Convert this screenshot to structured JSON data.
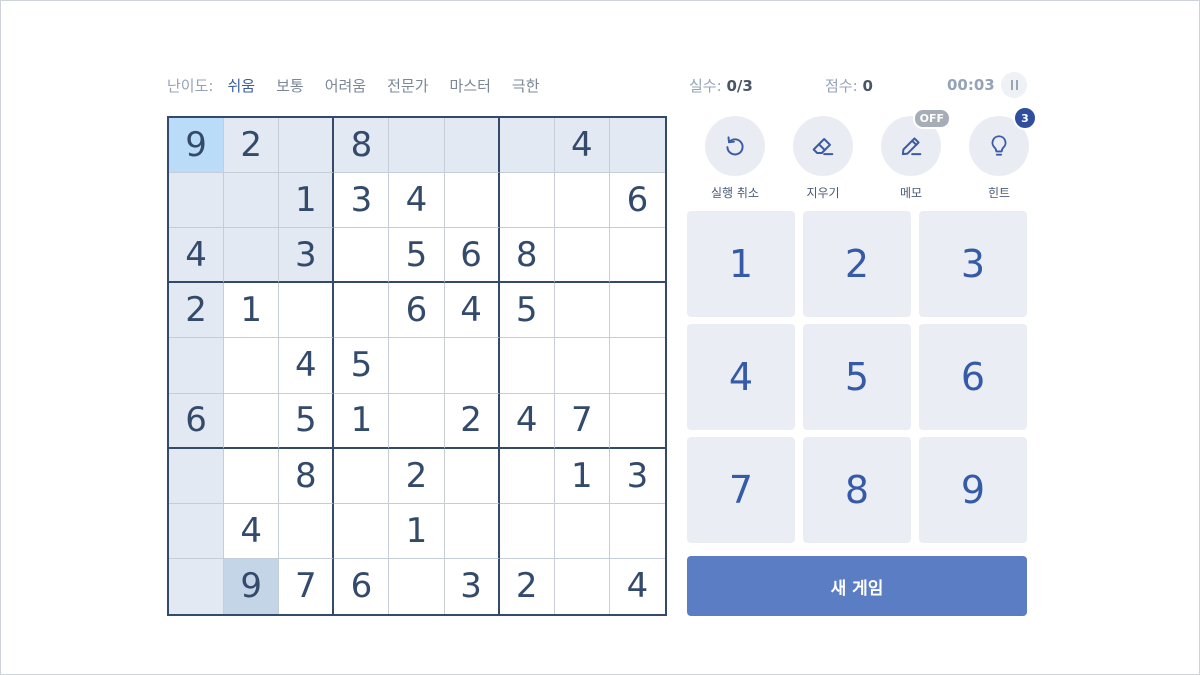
{
  "difficulty": {
    "label": "난이도:",
    "levels": [
      "쉬움",
      "보통",
      "어려움",
      "전문가",
      "마스터",
      "극한"
    ],
    "active_index": 0
  },
  "stats": {
    "errors_label": "실수:",
    "errors_value": "0/3",
    "score_label": "점수:",
    "score_value": "0",
    "timer": "00:03"
  },
  "board": {
    "cells": [
      [
        "9",
        "2",
        "",
        "8",
        "",
        "",
        "",
        "4",
        ""
      ],
      [
        "",
        "",
        "1",
        "3",
        "4",
        "",
        "",
        "",
        "6"
      ],
      [
        "4",
        "",
        "3",
        "",
        "5",
        "6",
        "8",
        "",
        ""
      ],
      [
        "2",
        "1",
        "",
        "",
        "6",
        "4",
        "5",
        "",
        ""
      ],
      [
        "",
        "",
        "4",
        "5",
        "",
        "",
        "",
        "",
        ""
      ],
      [
        "6",
        "",
        "5",
        "1",
        "",
        "2",
        "4",
        "7",
        ""
      ],
      [
        "",
        "",
        "8",
        "",
        "2",
        "",
        "",
        "1",
        "3"
      ],
      [
        "",
        "4",
        "",
        "",
        "1",
        "",
        "",
        "",
        ""
      ],
      [
        "",
        "9",
        "7",
        "6",
        "",
        "3",
        "2",
        "",
        "4"
      ]
    ],
    "selected": [
      0,
      0
    ],
    "same_value": [
      [
        8,
        1
      ]
    ]
  },
  "tools": {
    "undo": "실행 취소",
    "erase": "지우기",
    "notes": "메모",
    "notes_badge": "OFF",
    "hint": "힌트",
    "hint_badge": "3"
  },
  "numpad": [
    "1",
    "2",
    "3",
    "4",
    "5",
    "6",
    "7",
    "8",
    "9"
  ],
  "new_game": "새 게임",
  "colors": {
    "accent": "#345aa8",
    "button": "#5b7dc4",
    "board_line": "#344a6b",
    "highlight": "#e2e9f3",
    "selected": "#bbdcf8"
  }
}
